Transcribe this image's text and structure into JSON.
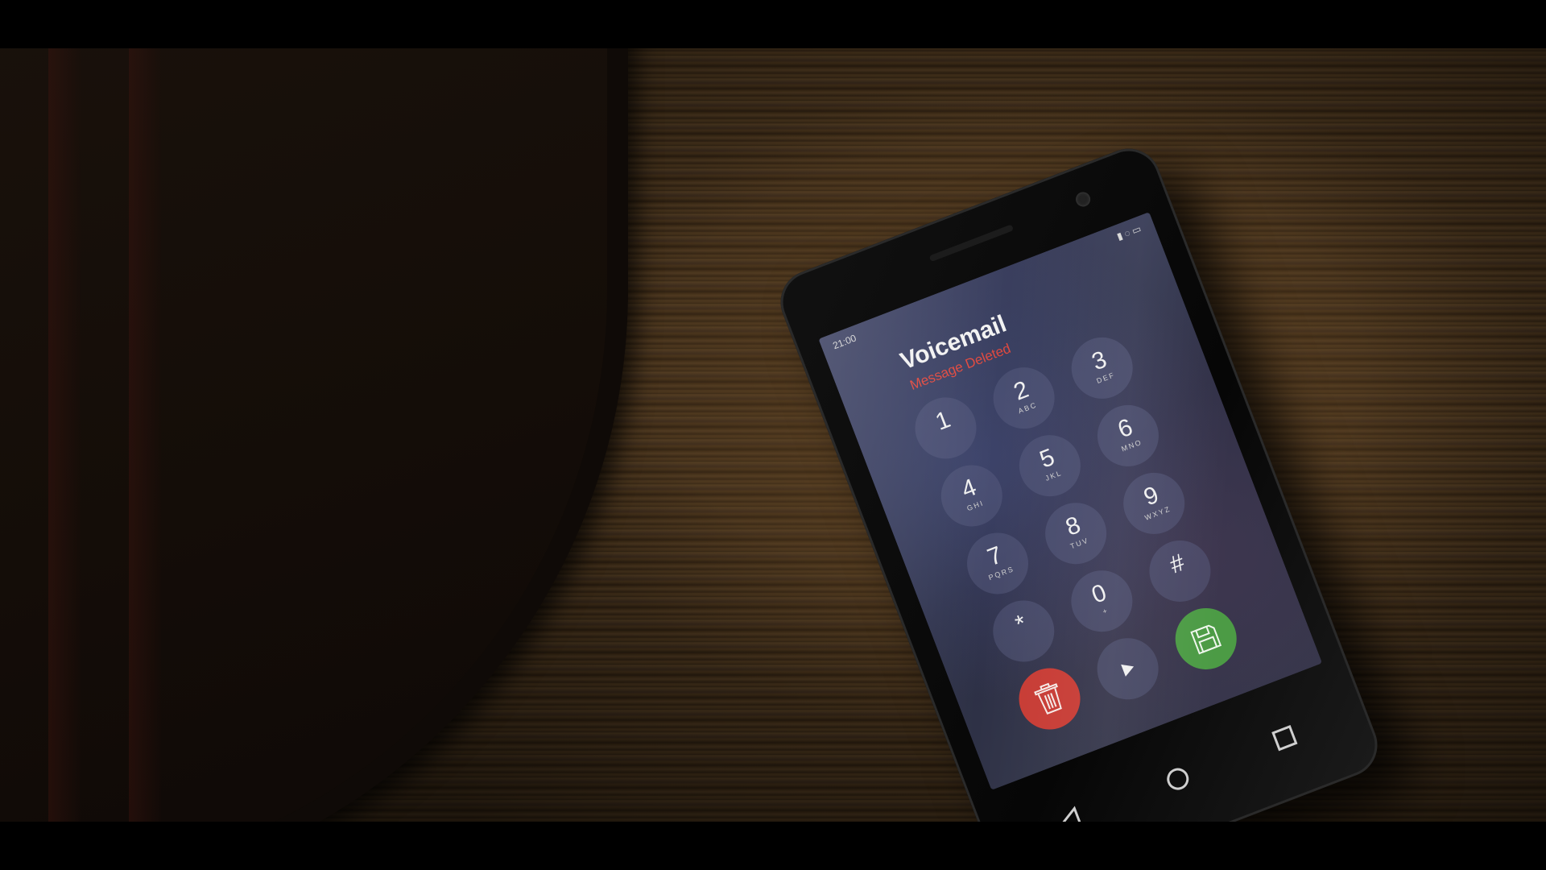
{
  "phone": {
    "status_bar": {
      "time": "21:00",
      "icons": "signal-icon wifi-icon battery-icon"
    },
    "app_title": "Voicemail",
    "app_status": "Message Deleted",
    "keypad": [
      {
        "digit": "1",
        "letters": ""
      },
      {
        "digit": "2",
        "letters": "ABC"
      },
      {
        "digit": "3",
        "letters": "DEF"
      },
      {
        "digit": "4",
        "letters": "GHI"
      },
      {
        "digit": "5",
        "letters": "JKL"
      },
      {
        "digit": "6",
        "letters": "MNO"
      },
      {
        "digit": "7",
        "letters": "PQRS"
      },
      {
        "digit": "8",
        "letters": "TUV"
      },
      {
        "digit": "9",
        "letters": "WXYZ"
      },
      {
        "digit": "*",
        "letters": ""
      },
      {
        "digit": "0",
        "letters": "+"
      },
      {
        "digit": "#",
        "letters": ""
      }
    ],
    "actions": {
      "delete_icon": "trash-icon",
      "play_icon": "play-icon",
      "save_icon": "floppy-disk-icon"
    },
    "navigation": {
      "back_icon": "back-triangle-icon",
      "home_icon": "home-circle-icon",
      "recent_icon": "recent-square-icon"
    }
  },
  "colors": {
    "delete": "#c73a33",
    "save": "#4c9b45",
    "status_red": "#e0493f",
    "table_wood": "#3a2916"
  }
}
